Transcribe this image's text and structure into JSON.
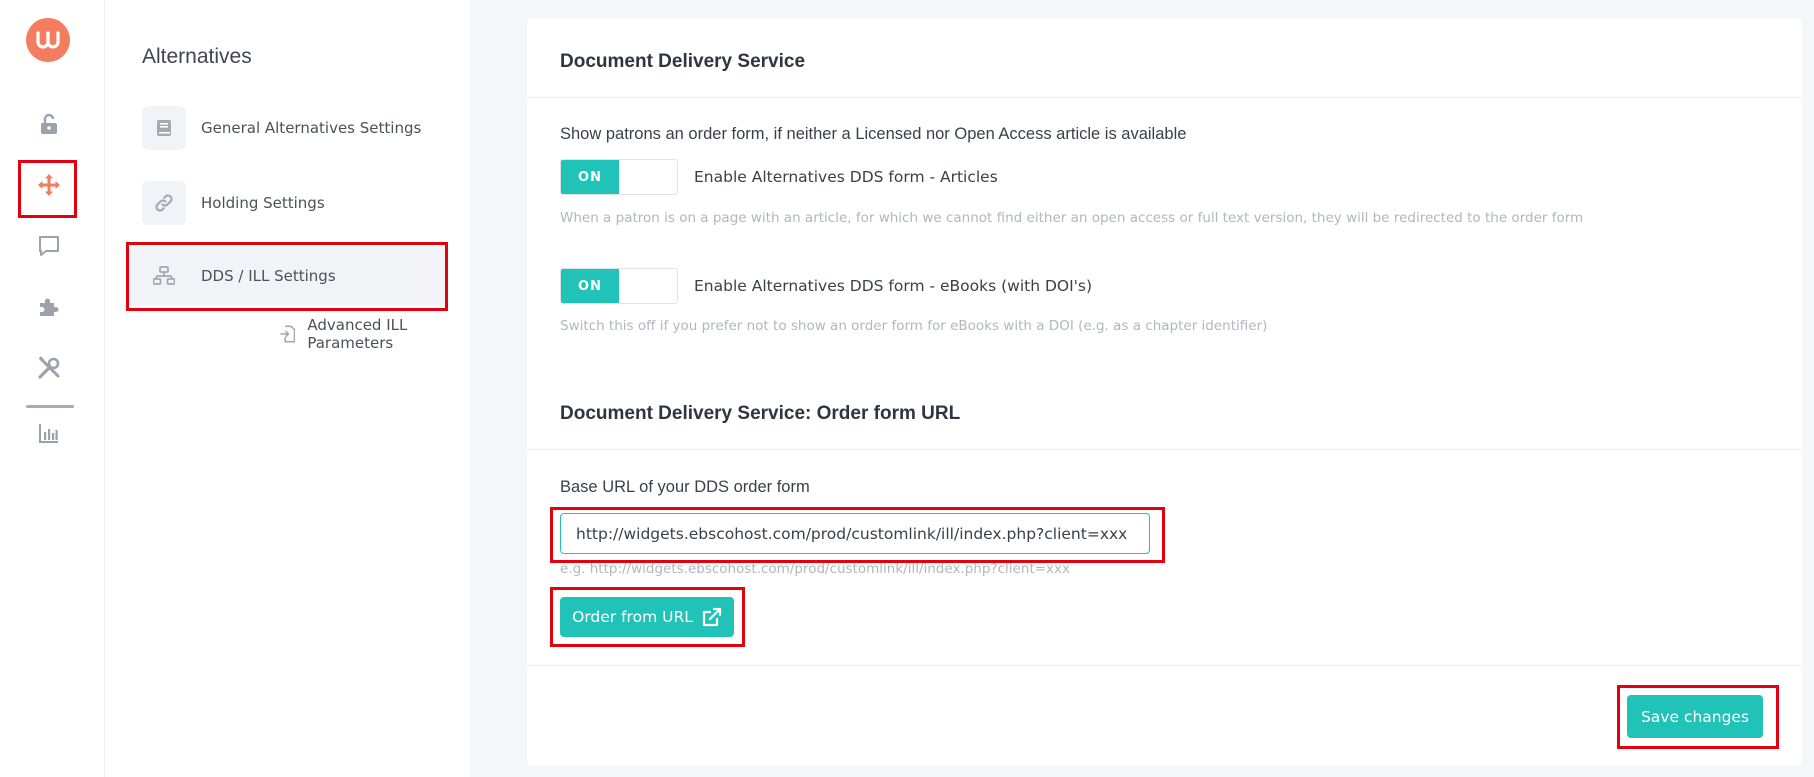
{
  "brand": {
    "logo_text": "LL",
    "accent": "#21c2b7",
    "logo_color": "#f47c5f",
    "highlight": "#e3000f"
  },
  "rail": {
    "items": [
      {
        "icon": "unlock-icon"
      },
      {
        "icon": "move-arrows-icon",
        "active": true
      },
      {
        "icon": "chat-icon"
      },
      {
        "icon": "puzzle-icon"
      },
      {
        "icon": "tools-icon"
      },
      {
        "icon": "bar-chart-icon"
      }
    ]
  },
  "sidebar": {
    "title": "Alternatives",
    "items": [
      {
        "label": "General Alternatives Settings",
        "icon": "book-icon"
      },
      {
        "label": "Holding Settings",
        "icon": "link-icon"
      },
      {
        "label": "DDS / ILL Settings",
        "icon": "network-icon",
        "active": true
      }
    ],
    "subitems": [
      {
        "label": "Advanced ILL Parameters",
        "icon": "file-import-icon"
      }
    ]
  },
  "main": {
    "section1": {
      "title": "Document Delivery Service",
      "question": "Show patrons an order form, if neither a Licensed nor Open Access article is available",
      "toggles": [
        {
          "state": "ON",
          "label": "Enable Alternatives DDS form - Articles",
          "help": "When a patron is on a page with an article, for which we cannot find either an open access or full text version, they will be redirected to the order form"
        },
        {
          "state": "ON",
          "label": "Enable Alternatives DDS form - eBooks (with DOI's)",
          "help": "Switch this off if you prefer not to show an order form for eBooks with a DOI (e.g. as a chapter identifier)"
        }
      ]
    },
    "section2": {
      "title": "Document Delivery Service: Order form URL",
      "field_label": "Base URL of your DDS order form",
      "url_value": "http://widgets.ebscohost.com/prod/customlink/ill/index.php?client=xxx",
      "url_example": "e.g. http://widgets.ebscohost.com/prod/customlink/ill/index.php?client=xxx",
      "order_button": "Order from URL"
    },
    "save_button": "Save changes"
  }
}
